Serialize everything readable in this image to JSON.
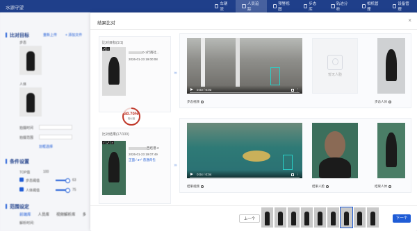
{
  "app": {
    "title": "水源守望"
  },
  "topnav": [
    {
      "label": "车辆流",
      "icon": "car-icon"
    },
    {
      "label": "人员追踪",
      "icon": "person-track-icon"
    },
    {
      "label": "预警视图",
      "icon": "alert-icon"
    },
    {
      "label": "步态库",
      "icon": "gait-icon"
    },
    {
      "label": "轨迹分析",
      "icon": "trajectory-icon"
    },
    {
      "label": "相机管理",
      "icon": "camera-icon"
    },
    {
      "label": "设备管理",
      "icon": "device-icon"
    }
  ],
  "sidebar": {
    "compare_title": "比对目标",
    "upload_label": "重新上传",
    "add_label": "+ 添加文件",
    "gait_label": "步态",
    "body_label": "人体",
    "time_label": "拍摄时间",
    "range_label": "拍摄范围",
    "region_label": "划框选择",
    "cond_title": "条件设置",
    "topk_label": "TOP值",
    "topk_value": "100",
    "gait_thresh_label": "步态阈值",
    "gait_thresh_value": "63",
    "body_thresh_label": "人体阈值",
    "body_thresh_value": "75",
    "scope_title": "范围设定",
    "tabs": [
      "前端库",
      "人员库",
      "视频解析库",
      "多"
    ],
    "file_label": "解析时间:"
  },
  "modal": {
    "title": "结果比对",
    "target_panel": {
      "label": "比对目标(1/1)",
      "id_text": "0-1行南社...",
      "timestamp": "2026-01-23 19:00:08"
    },
    "similarity": {
      "value": "80.70%",
      "label": "相似度",
      "fraction": 0.807
    },
    "result_panel": {
      "label": "比对结果(17/100)",
      "id_text": "西结港-2",
      "timestamp": "2026-01-23 19:07:49",
      "tags": "正面 / 37° 普通背包"
    },
    "rows": [
      {
        "video_time": "0:03 / 0:03",
        "video_label": "步态视频",
        "face_label": "暂无人脸",
        "body_label": "步态人体"
      },
      {
        "video_time": "0:04 / 0:04",
        "video_label": "结果视频",
        "face_label": "结果人脸",
        "body_label": "结果人体"
      }
    ],
    "buttons": {
      "prev": "上一个",
      "next": "下一个"
    }
  }
}
